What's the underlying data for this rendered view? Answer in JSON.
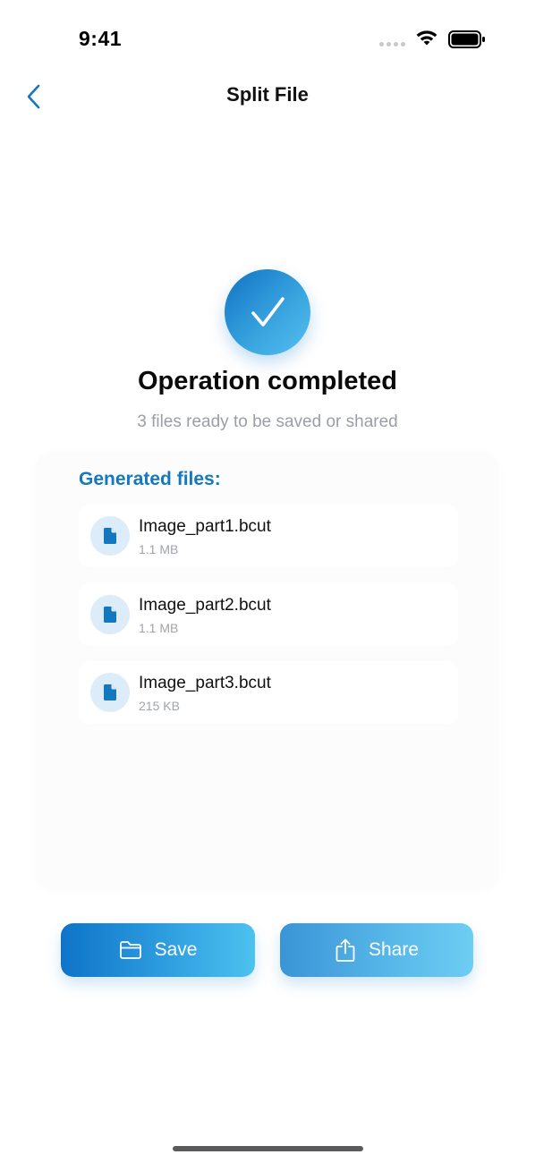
{
  "status_bar": {
    "time": "9:41"
  },
  "nav": {
    "title": "Split File",
    "back_icon": "chevron-left-icon"
  },
  "result": {
    "title": "Operation completed",
    "subtitle": "3 files ready to be saved or shared",
    "icon": "checkmark-icon"
  },
  "files": {
    "heading": "Generated files:",
    "items": [
      {
        "name": "Image_part1.bcut",
        "size": "1.1 MB"
      },
      {
        "name": "Image_part2.bcut",
        "size": "1.1 MB"
      },
      {
        "name": "Image_part3.bcut",
        "size": "215 KB"
      }
    ]
  },
  "actions": {
    "save_label": "Save",
    "share_label": "Share",
    "save_icon": "folder-icon",
    "share_icon": "share-icon"
  },
  "colors": {
    "accent": "#1478bf",
    "accent_light": "#4cc2ef",
    "muted_text": "#9a9ea6"
  }
}
